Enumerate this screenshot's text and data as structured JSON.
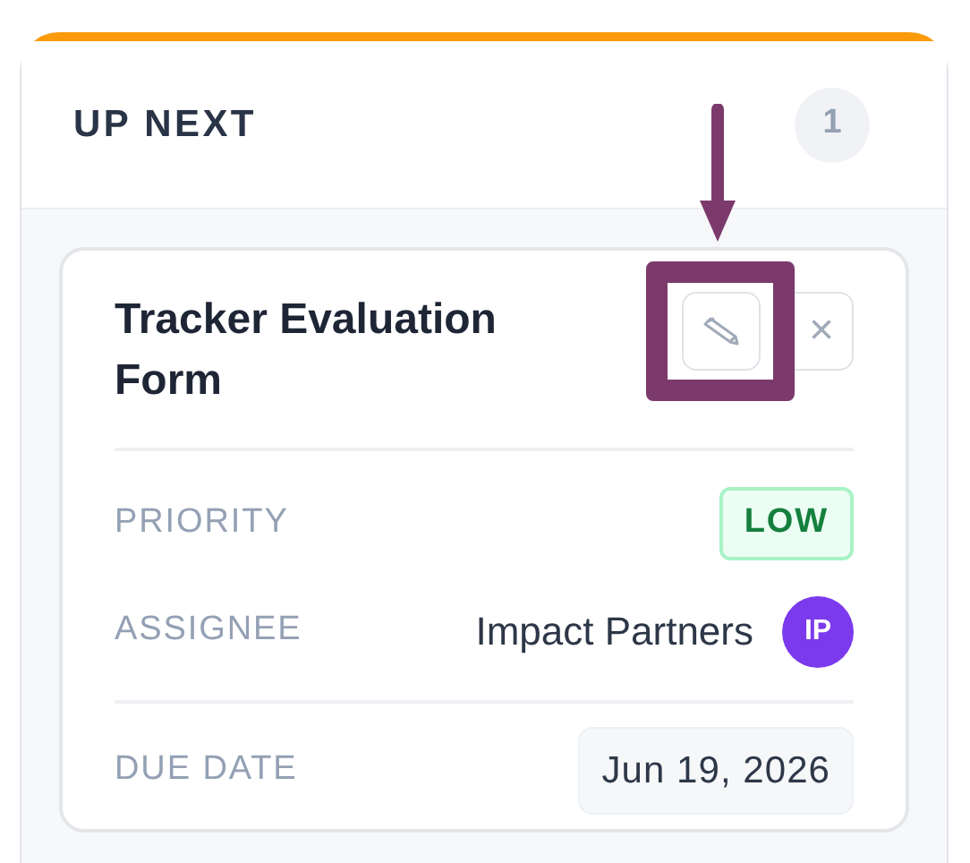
{
  "panel": {
    "title": "UP NEXT",
    "count": "1"
  },
  "task": {
    "title": "Tracker Evaluation Form",
    "close": "×",
    "fields": [
      {
        "kind": "badge",
        "label": "PRIORITY",
        "value": "LOW"
      },
      {
        "kind": "person",
        "label": "ASSIGNEE",
        "value": "Impact Partners",
        "initials": "IP",
        "color": "#7c3aed"
      },
      {
        "kind": "date",
        "label": "DUE DATE",
        "value": "Jun 19, 2026"
      }
    ]
  }
}
